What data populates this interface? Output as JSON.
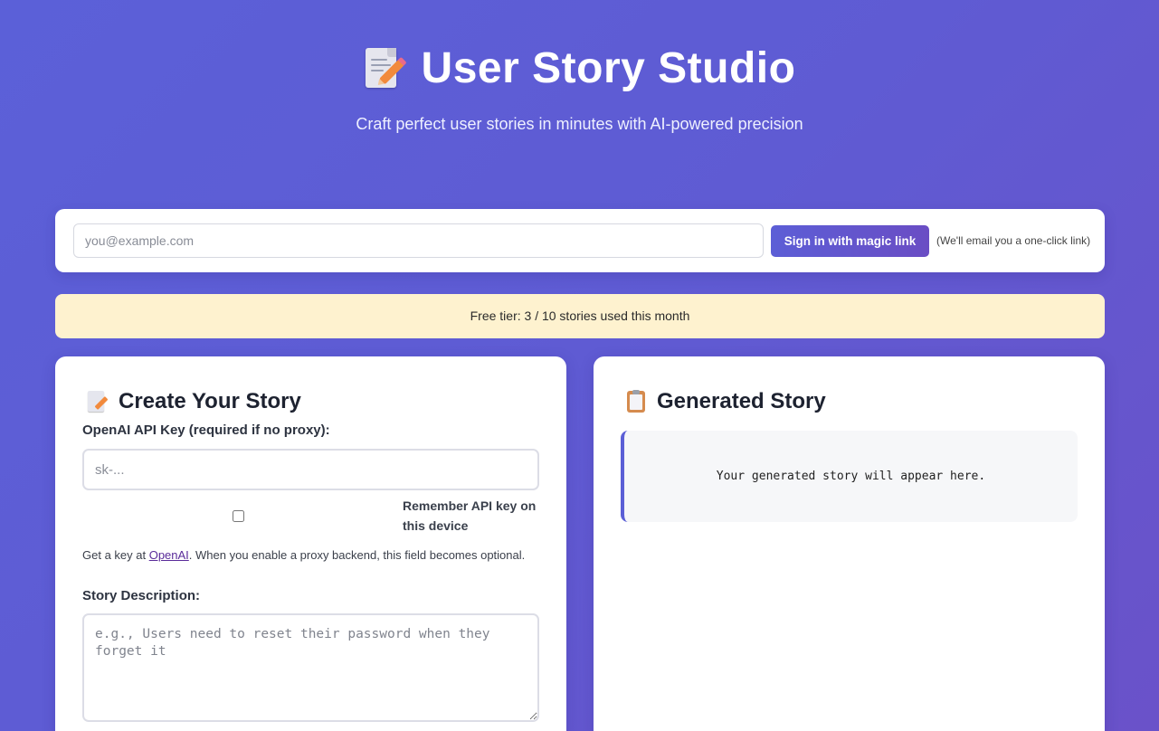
{
  "header": {
    "title": "User Story Studio",
    "subtitle": "Craft perfect user stories in minutes with AI-powered precision"
  },
  "signin": {
    "email_placeholder": "you@example.com",
    "button_label": "Sign in with magic link",
    "note": "(We'll email you a one-click link)"
  },
  "usage": {
    "text": "Free tier: 3 / 10 stories used this month"
  },
  "create_panel": {
    "title": "Create Your Story",
    "api_key_label": "OpenAI API Key (required if no proxy):",
    "api_key_placeholder": "sk-...",
    "remember_label": "Remember API key on this device",
    "hint_prefix": "Get a key at ",
    "hint_link": "OpenAI",
    "hint_suffix": ". When you enable a proxy backend, this field becomes optional.",
    "description_label": "Story Description:",
    "description_placeholder": "e.g., Users need to reset their password when they forget it"
  },
  "output_panel": {
    "title": "Generated Story",
    "placeholder_text": "Your generated story will appear here."
  },
  "icons": {
    "title_icon": "memo-icon",
    "create_icon": "memo-icon",
    "output_icon": "clipboard-icon"
  }
}
